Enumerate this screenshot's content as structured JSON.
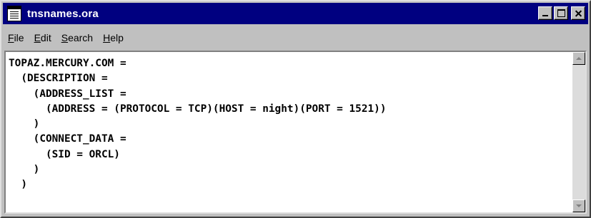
{
  "window": {
    "title": "tnsnames.ora",
    "icon": "notepad-icon"
  },
  "menu": {
    "file": {
      "accel": "F",
      "rest": "ile"
    },
    "edit": {
      "accel": "E",
      "rest": "dit"
    },
    "search": {
      "accel": "S",
      "rest": "earch"
    },
    "help": {
      "accel": "H",
      "rest": "elp"
    }
  },
  "editor": {
    "content": "TOPAZ.MERCURY.COM =\n  (DESCRIPTION =\n    (ADDRESS_LIST =\n      (ADDRESS = (PROTOCOL = TCP)(HOST = night)(PORT = 1521))\n    )\n    (CONNECT_DATA =\n      (SID = ORCL)\n    )\n  )"
  },
  "colors": {
    "titlebar": "#000080",
    "face": "#c0c0c0"
  }
}
